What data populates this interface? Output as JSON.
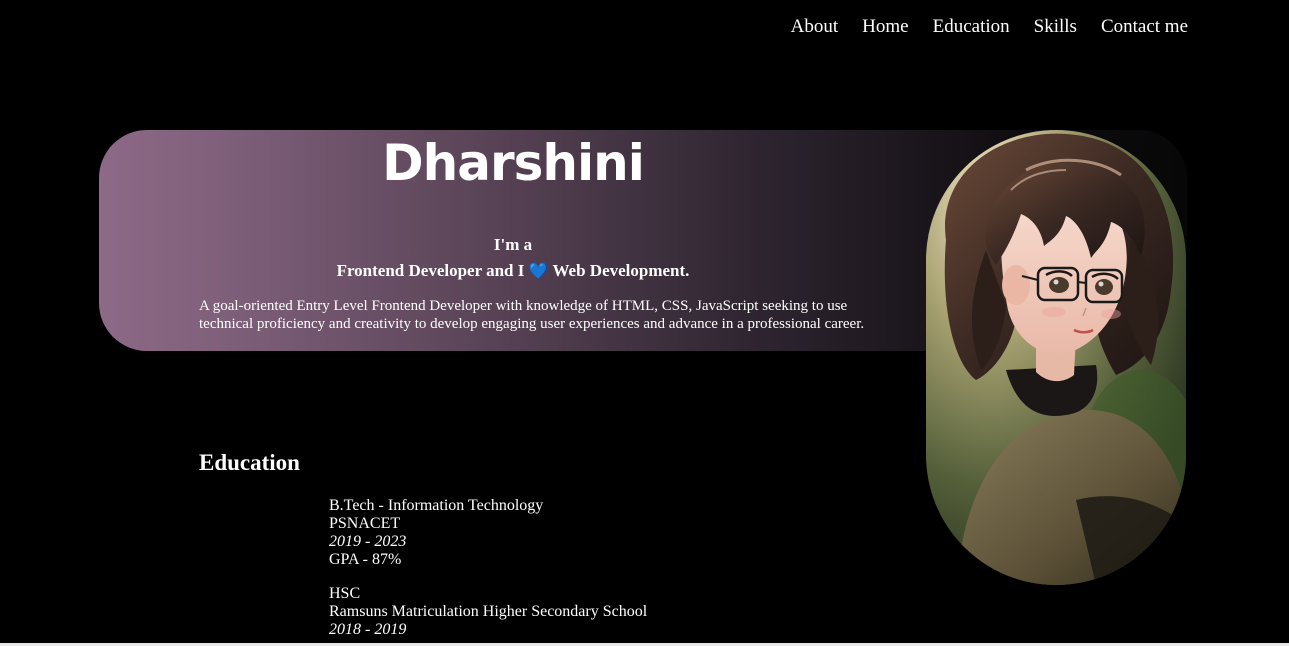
{
  "nav": {
    "items": [
      "About",
      "Home",
      "Education",
      "Skills",
      "Contact me"
    ]
  },
  "hero": {
    "name": "Dharshini",
    "intro_line1": "I'm a",
    "role_part1": "Frontend Developer and I",
    "heart": "💙",
    "role_part2": "Web Development.",
    "description": "A goal-oriented Entry Level Frontend Developer with knowledge of HTML, CSS, JavaScript seeking to use technical proficiency and creativity to develop engaging user experiences and advance in a professional career."
  },
  "education": {
    "heading": "Education",
    "items": [
      {
        "degree": "B.Tech - Information Technology",
        "institution": "PSNACET",
        "years": "2019 - 2023",
        "score": "GPA - 87%"
      },
      {
        "degree": "HSC",
        "institution": "Ramsuns Matriculation Higher Secondary School",
        "years": "2018 - 2019"
      }
    ]
  },
  "colors": {
    "background": "#000000",
    "text": "#ffffff",
    "hero_gradient_start": "#8d6a87",
    "hero_gradient_end": "#070707",
    "heart": "#2f7fe0"
  },
  "icons": {
    "heart": "blue-heart-icon",
    "portrait": "avatar-portrait-illustration"
  }
}
